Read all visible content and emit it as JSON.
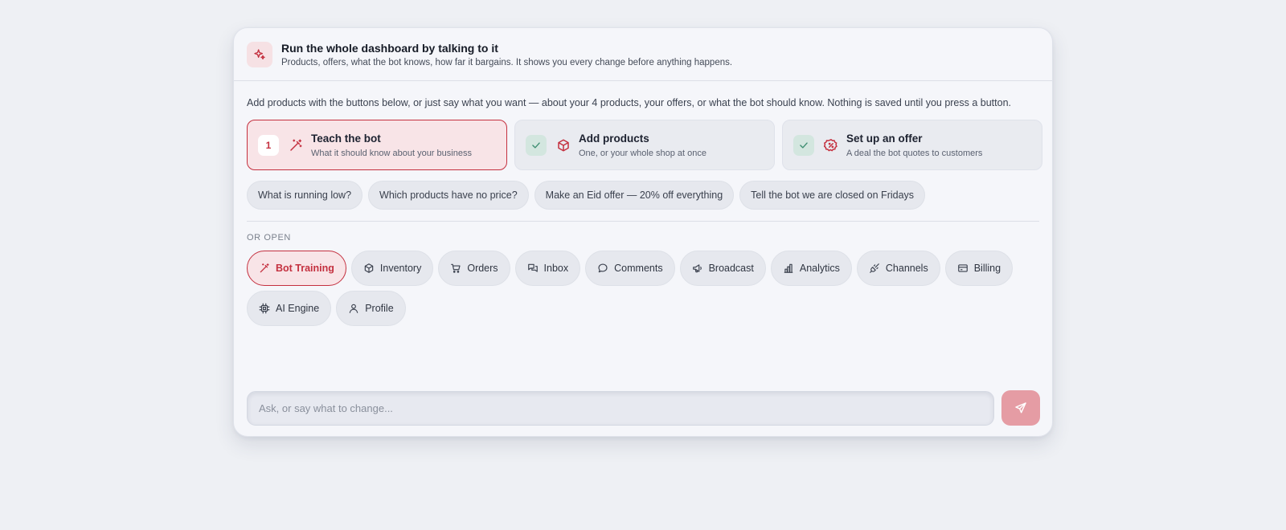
{
  "colors": {
    "accent": "#c4303f",
    "accent_bg": "#f8e4e7",
    "done_bg": "#d3e6df",
    "done_check": "#3f8f72",
    "send_bg": "#e59ca4"
  },
  "header": {
    "icon": "sparkles-icon",
    "title": "Run the whole dashboard by talking to it",
    "subtitle": "Products, offers, what the bot knows, how far it bargains. It shows you every change before anything happens."
  },
  "intro": "Add products with the buttons below, or just say what you want — about your 4 products, your offers, or what the bot should know. Nothing is saved until you press a button.",
  "steps": [
    {
      "badge": "1",
      "state": "active",
      "icon": "magic-wand-icon",
      "title": "Teach the bot",
      "subtitle": "What it should know about your business"
    },
    {
      "badge": "check-icon",
      "state": "done",
      "icon": "box-icon",
      "title": "Add products",
      "subtitle": "One, or your whole shop at once"
    },
    {
      "badge": "check-icon",
      "state": "done",
      "icon": "discount-badge-icon",
      "title": "Set up an offer",
      "subtitle": "A deal the bot quotes to customers"
    }
  ],
  "suggestions": [
    "What is running low?",
    "Which products have no price?",
    "Make an Eid offer — 20% off everything",
    "Tell the bot we are closed on Fridays"
  ],
  "or_open_label": "OR OPEN",
  "nav": [
    {
      "label": "Bot Training",
      "icon": "magic-wand-icon",
      "active": true
    },
    {
      "label": "Inventory",
      "icon": "box-icon"
    },
    {
      "label": "Orders",
      "icon": "cart-icon"
    },
    {
      "label": "Inbox",
      "icon": "messages-icon"
    },
    {
      "label": "Comments",
      "icon": "chat-bubble-icon"
    },
    {
      "label": "Broadcast",
      "icon": "megaphone-icon"
    },
    {
      "label": "Analytics",
      "icon": "bar-chart-icon"
    },
    {
      "label": "Channels",
      "icon": "plug-icon"
    },
    {
      "label": "Billing",
      "icon": "credit-card-icon"
    },
    {
      "label": "AI Engine",
      "icon": "cpu-icon"
    },
    {
      "label": "Profile",
      "icon": "user-icon"
    }
  ],
  "composer": {
    "placeholder": "Ask, or say what to change...",
    "send_icon": "send-icon"
  }
}
